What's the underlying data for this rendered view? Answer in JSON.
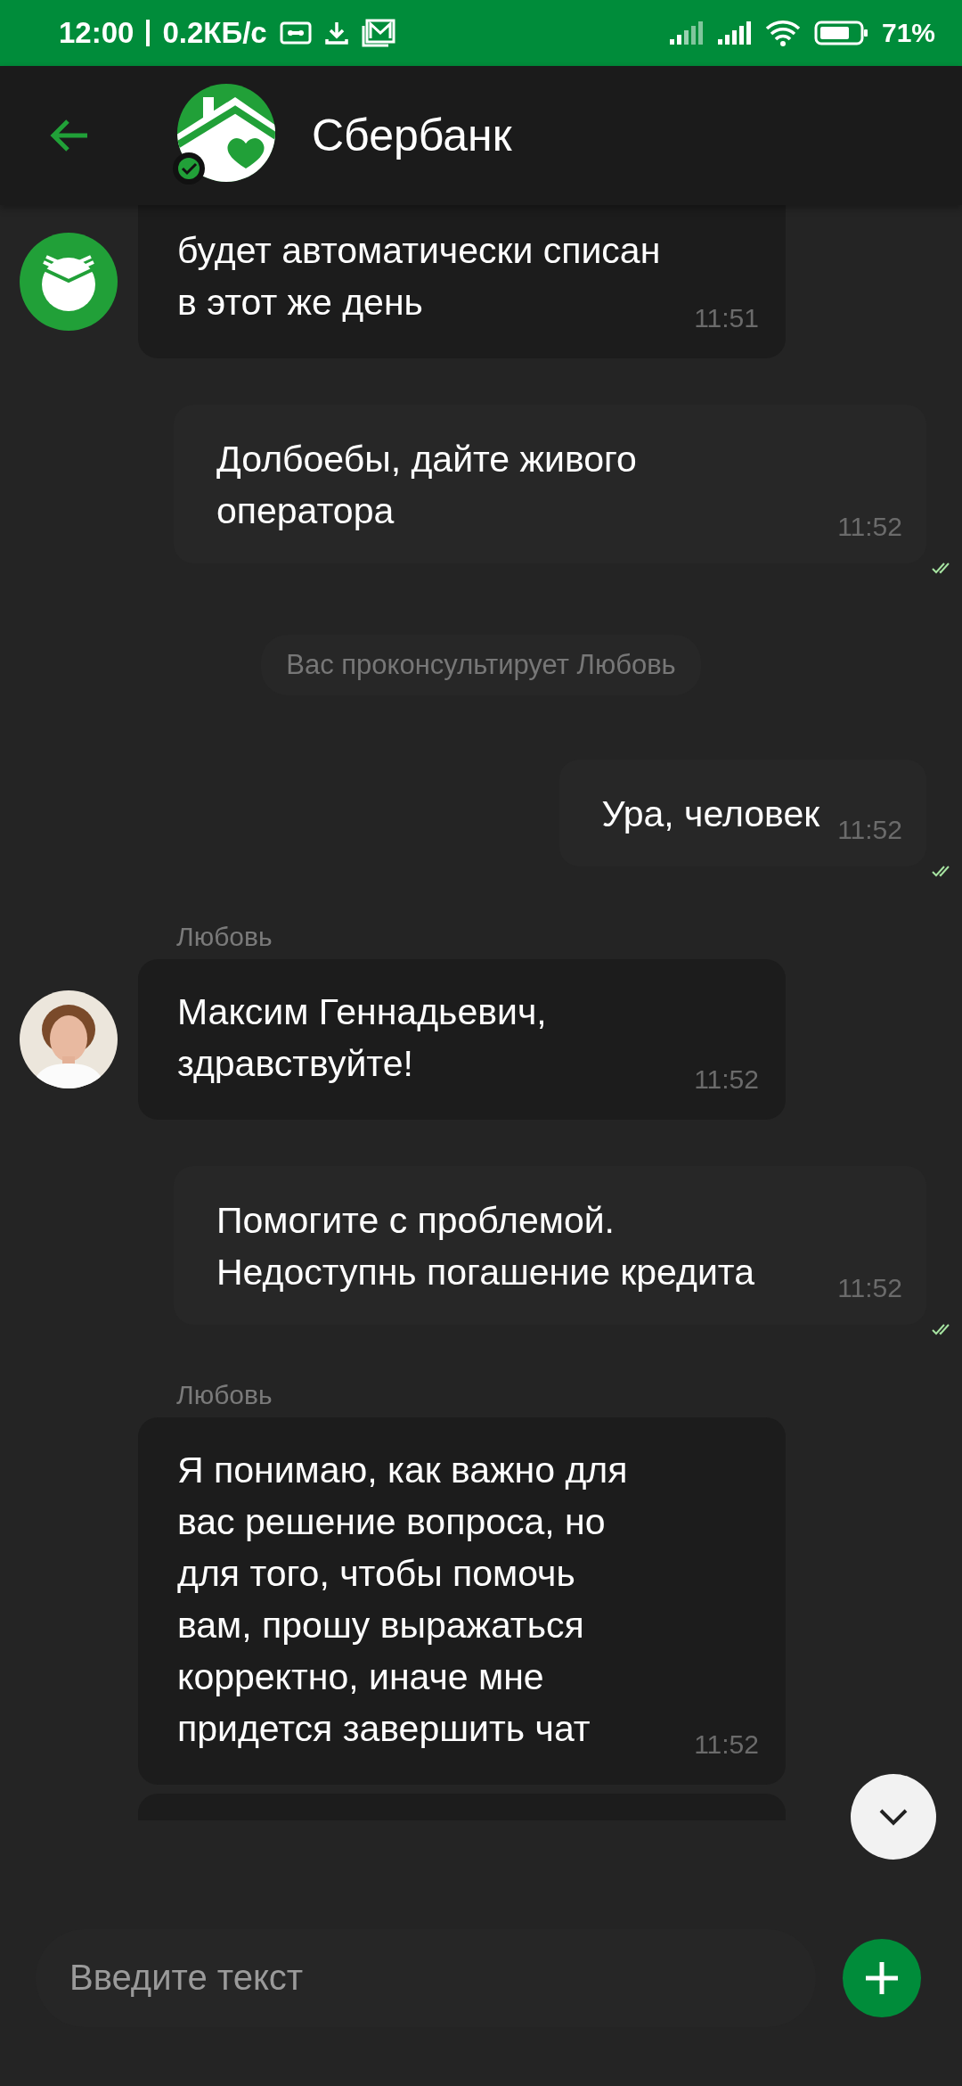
{
  "status_bar": {
    "time": "12:00",
    "speed": "0.2КБ/с",
    "battery": "71%"
  },
  "header": {
    "title": "Сбербанк"
  },
  "messages": [
    {
      "kind": "incoming",
      "avatar": {
        "kind": "logo"
      },
      "text": "будет автоматически списан\nв этот же день",
      "time": "11:51"
    },
    {
      "kind": "outgoing",
      "text": "Долбоебы, дайте живого\nоператора",
      "time": "11:52",
      "read": true
    },
    {
      "kind": "system",
      "text": "Вас проконсультирует Любовь"
    },
    {
      "kind": "outgoing",
      "text": "Ура, человек",
      "time": "11:52",
      "read": true
    },
    {
      "kind": "incoming",
      "sender": "Любовь",
      "text": "Максим Геннадьевич,\nздравствуйте!",
      "time": "11:52"
    },
    {
      "kind": "outgoing",
      "text": "Помогите с проблемой.\nНедоступнь погашение кредита",
      "time": "11:52",
      "read": true
    },
    {
      "kind": "incoming",
      "sender": "Любовь",
      "text": "Я понимаю, как важно для\nвас решение вопроса, но\nдля того, чтобы помочь\nвам, прошу выражаться\nкорректно, иначе мне\nпридется завершить чат",
      "time": "11:52"
    },
    {
      "kind": "partial"
    }
  ],
  "composer": {
    "placeholder": "Введите текст"
  }
}
